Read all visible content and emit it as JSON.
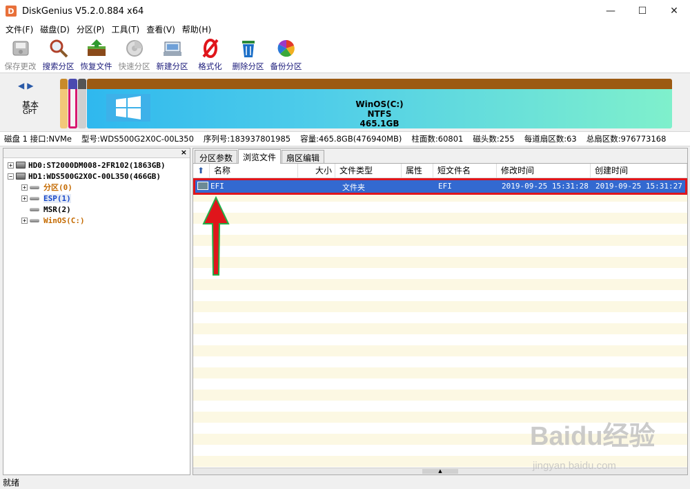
{
  "window": {
    "title": "DiskGenius V5.2.0.884 x64",
    "minimize": "—",
    "maximize": "☐",
    "close": "✕"
  },
  "menu": [
    "文件(F)",
    "磁盘(D)",
    "分区(P)",
    "工具(T)",
    "查看(V)",
    "帮助(H)"
  ],
  "toolbar": [
    {
      "label": "保存更改",
      "icon": "save-icon",
      "enabled": false
    },
    {
      "label": "搜索分区",
      "icon": "search-icon",
      "enabled": true
    },
    {
      "label": "恢复文件",
      "icon": "recover-icon",
      "enabled": true
    },
    {
      "label": "快速分区",
      "icon": "quick-partition-icon",
      "enabled": false
    },
    {
      "label": "新建分区",
      "icon": "new-partition-icon",
      "enabled": true
    },
    {
      "label": "格式化",
      "icon": "format-icon",
      "enabled": true
    },
    {
      "label": "删除分区",
      "icon": "delete-icon",
      "enabled": true
    },
    {
      "label": "备份分区",
      "icon": "backup-icon",
      "enabled": true
    }
  ],
  "diskmap": {
    "type": "基本",
    "scheme": "GPT",
    "main_partition": {
      "name": "WinOS(C:)",
      "fs": "NTFS",
      "size": "465.1GB"
    }
  },
  "diskinfo": {
    "disk": "磁盘 1 接口:NVMe",
    "model": "型号:WDS500G2X0C-00L350",
    "serial": "序列号:183937801985",
    "capacity": "容量:465.8GB(476940MB)",
    "cylinders": "柱面数:60801",
    "heads": "磁头数:255",
    "sectors_per_track": "每道扇区数:63",
    "total_sectors": "总扇区数:976773168"
  },
  "tree": {
    "close": "×",
    "items": [
      {
        "label": "HD0:ST2000DM008-2FR102(1863GB)",
        "kind": "disk"
      },
      {
        "label": "HD1:WDS500G2X0C-00L350(466GB)",
        "kind": "disk"
      },
      {
        "label": "分区(0)",
        "kind": "partition",
        "color": "#c46a00"
      },
      {
        "label": "ESP(1)",
        "kind": "partition",
        "color": "#1848c8"
      },
      {
        "label": "MSR(2)",
        "kind": "partition",
        "color": "#000000"
      },
      {
        "label": "WinOS(C:)",
        "kind": "partition",
        "color": "#c46a00"
      }
    ]
  },
  "tabs": [
    "分区参数",
    "浏览文件",
    "扇区编辑"
  ],
  "active_tab": "浏览文件",
  "columns": [
    "名称",
    "大小",
    "文件类型",
    "属性",
    "短文件名",
    "修改时间",
    "创建时间"
  ],
  "rows": [
    {
      "name": "EFI",
      "size": "",
      "type": "文件夹",
      "attr": "",
      "short": "EFI",
      "modified": "2019-09-25 15:31:28",
      "created": "2019-09-25 15:31:27"
    }
  ],
  "status": "就绪",
  "watermark": {
    "main": "Baidu经验",
    "sub": "jingyan.baidu.com"
  }
}
